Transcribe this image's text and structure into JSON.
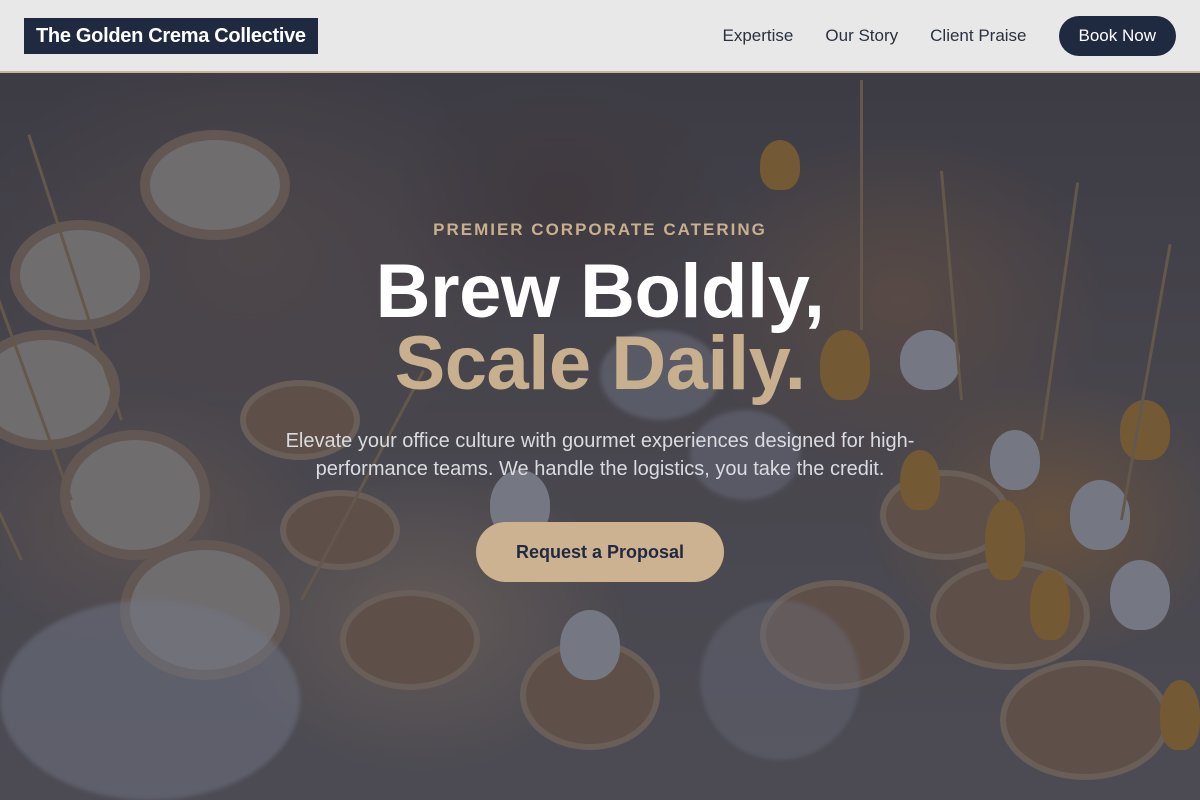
{
  "header": {
    "brand": "The Golden Crema Collective",
    "nav_items": [
      {
        "label": "Expertise"
      },
      {
        "label": "Our Story"
      },
      {
        "label": "Client Praise"
      }
    ],
    "cta_label": "Book Now"
  },
  "hero": {
    "eyebrow": "PREMIER CORPORATE CATERING",
    "headline_line1": "Brew Boldly,",
    "headline_line2": "Scale Daily.",
    "subcopy": "Elevate your office culture with gourmet experiences designed for high-performance teams. We handle the logistics, you take the credit.",
    "button_label": "Request a Proposal"
  },
  "colors": {
    "navy": "#1f2940",
    "gold": "#c8b08f",
    "button_gold": "#cdb291",
    "header_bg": "#f3f3f3"
  }
}
